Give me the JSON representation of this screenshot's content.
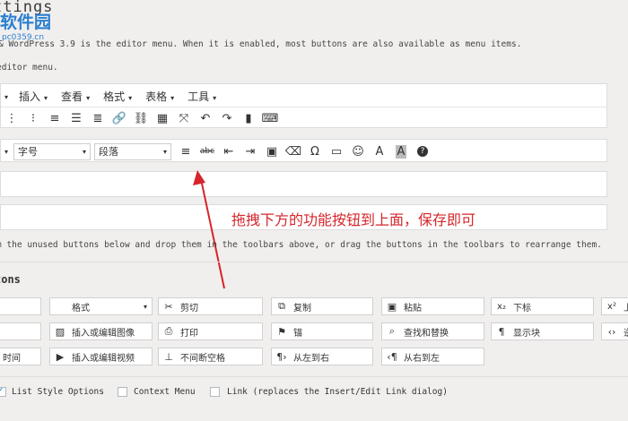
{
  "page": {
    "title": "ttings",
    "watermark": {
      "name": "软件园",
      "url": "pc0359.cn"
    },
    "desc1": "& WordPress 3.9 is the editor menu. When it is enabled, most buttons are also available as menu items.",
    "desc2": "editor menu.",
    "instruction": "m the unused buttons below and drop them in the toolbars above, or drag the buttons in the toolbars to rearrange them.",
    "section_title": "tons"
  },
  "menubar": [
    "插入",
    "查看",
    "格式",
    "表格",
    "工具"
  ],
  "toolbar1_icons": [
    "bulleted-list-icon",
    "numbered-list-icon",
    "align-left-icon",
    "align-center-icon",
    "align-right-icon",
    "link-icon",
    "unlink-icon",
    "table-icon",
    "fullscreen-icon",
    "undo-icon",
    "redo-icon",
    "paste-text-icon",
    "keyboard-icon"
  ],
  "toolbar2": {
    "font_size_label": "字号",
    "paragraph_label": "段落",
    "icons": [
      "horizontal-rule-icon",
      "strikethrough-icon",
      "outdent-icon",
      "indent-icon",
      "paste-icon",
      "eraser-icon",
      "omega-icon",
      "hr-icon",
      "emoji-icon",
      "text-color-icon",
      "background-color-icon",
      "help-icon"
    ]
  },
  "callout": "拖拽下方的功能按钮到上面，保存即可",
  "accent_color": "#d6262b",
  "unused_buttons": {
    "row1": [
      {
        "label": "",
        "icon": ""
      },
      {
        "label": "格式",
        "icon": "",
        "dropdown": true
      },
      {
        "label": "剪切",
        "icon": "✂"
      },
      {
        "label": "复制",
        "icon": "⧉"
      },
      {
        "label": "粘贴",
        "icon": "📋"
      },
      {
        "label": "下标",
        "icon": "x₂"
      },
      {
        "label": "上",
        "icon": "x²"
      }
    ],
    "row2": [
      {
        "label": "",
        "icon": ""
      },
      {
        "label": "插入或编辑图像",
        "icon": "▨"
      },
      {
        "label": "打印",
        "icon": "⎙"
      },
      {
        "label": "锚",
        "icon": "⚑"
      },
      {
        "label": "查找和替换",
        "icon": "⌕"
      },
      {
        "label": "显示块",
        "icon": "¶"
      },
      {
        "label": "逆",
        "icon": "‹›"
      }
    ],
    "row3": [
      {
        "label": "时间",
        "icon": ""
      },
      {
        "label": "插入或编辑视频",
        "icon": "▶"
      },
      {
        "label": "不间断空格",
        "icon": "⊥"
      },
      {
        "label": "从左到右",
        "icon": "¶"
      },
      {
        "label": "从右到左",
        "icon": "¶"
      }
    ]
  },
  "options": [
    {
      "label": "List Style Options",
      "checked": true
    },
    {
      "label": "Context Menu",
      "checked": false
    },
    {
      "label": "Link (replaces the Insert/Edit Link dialog)",
      "checked": false
    }
  ]
}
